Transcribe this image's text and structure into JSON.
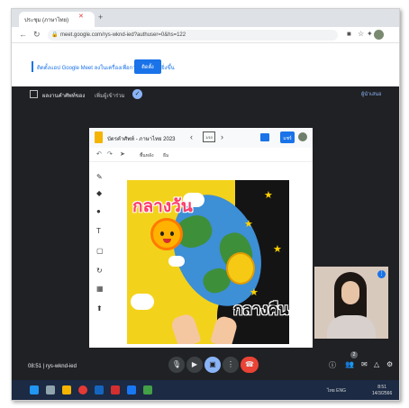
{
  "browser": {
    "tab_title": "ประชุม (ภาษาไทย)",
    "url": "meet.google.com/rys-wknd-ied?authuser=0&hs=122",
    "banner_text": "ติดตั้งแอป Google Meet ลงในเครื่องเพื่อการใช้งานที่ดียิ่งขึ้น",
    "banner_button": "ติดตั้ง"
  },
  "meet": {
    "title": "ผลงานคำศัพท์ของ",
    "subtitle": "เพิ่มผู้เข้าร่วม",
    "right_label": "ผู้นำเสนอ",
    "meeting_code": "08:51 | rys-wknd-ied",
    "people_count": "2"
  },
  "editor": {
    "doc_title": "บัตรคำศัพท์ - ภาษาไทย 2023",
    "slide_box": "1/10",
    "share_label": "แชร์",
    "menu_1": "พื้นหลัง",
    "menu_2": "ธีม"
  },
  "slide": {
    "title_top": "กลางวัน",
    "title_bottom": "กลางคืน",
    "bg_color": "#f3d21c",
    "title_color": "#ff3b6b"
  },
  "icons": {
    "mic": "mic-icon",
    "camera": "camera-icon",
    "present": "present-icon",
    "more": "more-vert-icon",
    "leave": "call-end-icon"
  },
  "taskbar": {
    "time": "8:51",
    "date": "14/3/2566",
    "tray": "ไทย ENG"
  }
}
